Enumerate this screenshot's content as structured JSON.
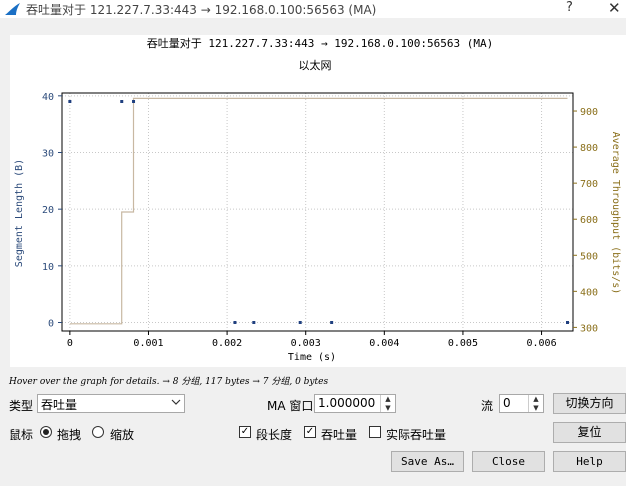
{
  "window": {
    "title": "吞吐量对于 121.227.7.33:443 → 192.168.0.100:56563 (MA)",
    "help_glyph": "?",
    "close_glyph": "✕"
  },
  "chart_data": {
    "type": "scatter",
    "title": "吞吐量对于 121.227.7.33:443 → 192.168.0.100:56563 (MA)",
    "subtitle": "以太网",
    "xlabel": "Time (s)",
    "ylabel": "Segment Length (B)",
    "y2label": "Average Throughput (bits/s)",
    "xlim": [
      -0.0001,
      0.0064
    ],
    "ylim": [
      -1.5,
      40.5
    ],
    "y2lim": [
      290,
      950
    ],
    "xticks": [
      "0",
      "0.001",
      "0.002",
      "0.003",
      "0.004",
      "0.005",
      "0.006"
    ],
    "xtick_values": [
      0,
      0.001,
      0.002,
      0.003,
      0.004,
      0.005,
      0.006
    ],
    "yticks": [
      "0",
      "10",
      "20",
      "30",
      "40"
    ],
    "ytick_values": [
      0,
      10,
      20,
      30,
      40
    ],
    "y2ticks": [
      "300",
      "400",
      "500",
      "600",
      "700",
      "800",
      "900"
    ],
    "y2tick_values": [
      300,
      400,
      500,
      600,
      700,
      800,
      900
    ],
    "grid": true,
    "colors": {
      "points": "#1f3f7f",
      "throughput": "#c8b8a2",
      "axis_right": "#8a6f1a",
      "axis_left": "#2b4a7a"
    },
    "series": [
      {
        "kind": "points",
        "axis": "left",
        "x": [
          0.0,
          0.00066,
          0.00081,
          0.0021,
          0.00234,
          0.00293,
          0.00333,
          0.00633
        ],
        "y": [
          39,
          39,
          39,
          0,
          0,
          0,
          0,
          0
        ]
      },
      {
        "kind": "step",
        "axis": "right",
        "x": [
          0.0,
          0.00066,
          0.00066,
          0.00081,
          0.00081,
          0.00633
        ],
        "y": [
          310,
          310,
          620,
          620,
          935,
          935
        ]
      }
    ]
  },
  "info": "Hover over the graph for details. → 8 分组, 117 bytes → 7 分组, 0 bytes",
  "controls": {
    "type_label": "类型",
    "type_value": "吞吐量",
    "ma_label": "MA 窗口",
    "ma_value": "1.000000",
    "stream_label": "流",
    "stream_value": "0",
    "switch_direction": "切换方向",
    "mouse_label": "鼠标",
    "drag_label": "拖拽",
    "zoom_label": "缩放",
    "seg_length_label": "段长度",
    "throughput_label": "吞吐量",
    "actual_throughput_label": "实际吞吐量",
    "reset": "复位",
    "save_as": "Save As…",
    "close": "Close",
    "help": "Help"
  }
}
